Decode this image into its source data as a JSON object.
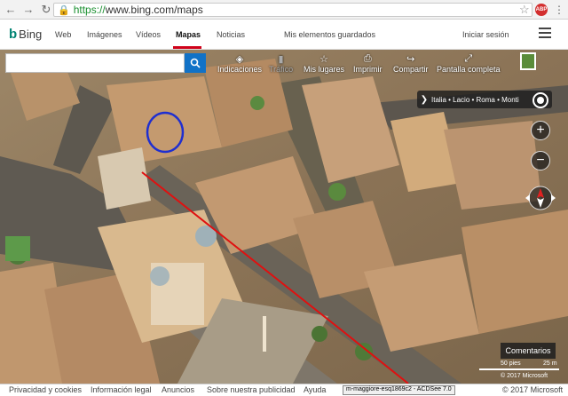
{
  "browser": {
    "url_scheme": "https://",
    "url_host": "www.bing.com/maps",
    "abp_label": "ABP"
  },
  "header": {
    "logo_text": "Bing",
    "nav": [
      "Web",
      "Imágenes",
      "Vídeos",
      "Mapas",
      "Noticias"
    ],
    "saved": "Mis elementos guardados",
    "signin": "Iniciar sesión"
  },
  "toolbar": {
    "directions": "Indicaciones",
    "traffic": "Tráfico",
    "my_places": "Mis lugares",
    "print": "Imprimir",
    "share": "Compartir",
    "fullscreen": "Pantalla completa"
  },
  "breadcrumb": "Italia • Lacio • Roma • Monti",
  "map": {
    "comments": "Comentarios",
    "scale_ft": "50 pies",
    "scale_m": "25 m",
    "copyright": "© 2017 Microsoft",
    "route_color": "#e01010",
    "circle_color": "#1f2fd0"
  },
  "footer": {
    "privacy": "Privacidad y cookies",
    "legal": "Información legal",
    "ads": "Anuncios",
    "about_ads": "Sobre nuestra publicidad",
    "help": "Ayuda",
    "acdsee": "m-maggiore-esq1869c2 - ACDSee 7.0",
    "copyright": "© 2017 Microsoft"
  }
}
